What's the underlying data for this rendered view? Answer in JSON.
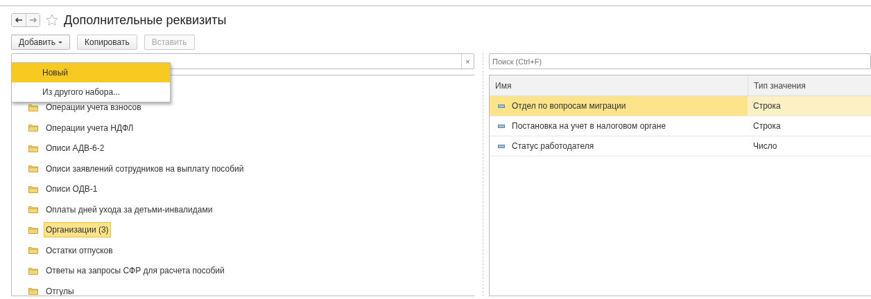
{
  "window": {
    "title": "Дополнительные реквизиты",
    "favorite": false
  },
  "toolbar": {
    "buttons": [
      {
        "label": "Добавить",
        "kind": "dropdown",
        "disabled": false,
        "focused": true
      },
      {
        "label": "Копировать",
        "kind": "plain",
        "disabled": false,
        "focused": false
      },
      {
        "label": "Вставить",
        "kind": "plain",
        "disabled": true,
        "focused": false
      }
    ]
  },
  "add_menu": {
    "items": [
      {
        "label": "Новый",
        "selected": true
      },
      {
        "label": "Из другого набора...",
        "selected": false
      }
    ]
  },
  "left_search": {
    "clear": "×"
  },
  "tree": {
    "items": [
      {
        "label": "Операции учета взносов",
        "selected": false
      },
      {
        "label": "Операции учета НДФЛ",
        "selected": false
      },
      {
        "label": "Описи АДВ-6-2",
        "selected": false
      },
      {
        "label": "Описи заявлений сотрудников на выплату пособий",
        "selected": false
      },
      {
        "label": "Описи ОДВ-1",
        "selected": false
      },
      {
        "label": "Оплаты дней ухода за детьми-инвалидами",
        "selected": false
      },
      {
        "label": "Организации (3)",
        "selected": true
      },
      {
        "label": "Остатки отпусков",
        "selected": false
      },
      {
        "label": "Ответы на запросы СФР для расчета пособий",
        "selected": false
      },
      {
        "label": "Отгулы",
        "selected": false
      }
    ]
  },
  "right_search": {
    "placeholder": "Поиск (Ctrl+F)"
  },
  "table": {
    "columns": [
      "Имя",
      "Тип значения"
    ],
    "rows": [
      {
        "name": "Отдел по вопросам миграции",
        "type": "Строка",
        "selected": true
      },
      {
        "name": "Постановка на учет в налоговом органе",
        "type": "Строка",
        "selected": false
      },
      {
        "name": "Статус работодателя",
        "type": "Число",
        "selected": false
      }
    ]
  }
}
